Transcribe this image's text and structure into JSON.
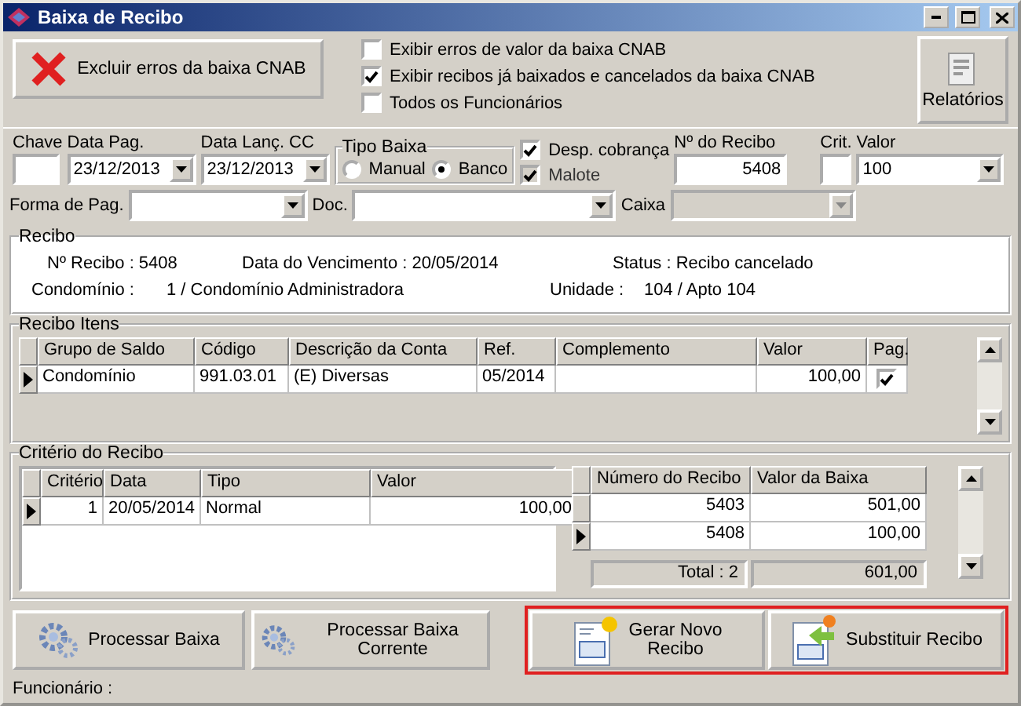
{
  "window": {
    "title": "Baixa de Recibo"
  },
  "toolbar": {
    "delete_button": "Excluir erros da baixa CNAB",
    "checkboxes": [
      {
        "label": "Exibir erros de valor da baixa CNAB",
        "checked": false
      },
      {
        "label": "Exibir recibos já baixados e cancelados da baixa CNAB",
        "checked": true
      },
      {
        "label": "Todos os Funcionários",
        "checked": false
      }
    ],
    "reports_button": "Relatórios"
  },
  "filters": {
    "chave": {
      "label": "Chave"
    },
    "data_pag": {
      "label": "Data Pag.",
      "value": "23/12/2013"
    },
    "data_lanc": {
      "label": "Data Lanç. CC",
      "value": "23/12/2013"
    },
    "tipo_baixa": {
      "label": "Tipo Baixa",
      "options": [
        {
          "label": "Manual",
          "selected": false
        },
        {
          "label": "Banco",
          "selected": true
        }
      ]
    },
    "options": [
      {
        "label": "Desp. cobrança",
        "checked": true,
        "disabled": false
      },
      {
        "label": "Malote",
        "checked": true,
        "disabled": true
      }
    ],
    "numero_recibo": {
      "label": "Nº do Recibo",
      "value": "5408"
    },
    "crit": {
      "label": "Crit."
    },
    "valor": {
      "label": "Valor",
      "value": "100"
    },
    "forma_pag": {
      "label": "Forma de Pag."
    },
    "doc": {
      "label": "Doc."
    },
    "caixa": {
      "label": "Caixa",
      "disabled": true
    }
  },
  "recibo": {
    "title": "Recibo",
    "rows": [
      [
        "Nº Recibo : 5408",
        "Data do Vencimento : 20/05/2014",
        "Status : Recibo cancelado"
      ],
      [
        "Condomínio :",
        "1 /  Condomínio Administradora",
        "Unidade :",
        "104 /  Apto 104"
      ]
    ]
  },
  "recibo_itens": {
    "title": "Recibo Itens",
    "columns": [
      "Grupo de Saldo",
      "Código",
      "Descrição da Conta",
      "Ref.",
      "Complemento",
      "Valor",
      "Pag."
    ],
    "rows": [
      {
        "current": true,
        "cells": [
          "Condomínio",
          "991.03.01",
          "(E) Diversas",
          "05/2014",
          "",
          "100,00"
        ],
        "paid": true
      }
    ]
  },
  "criterio": {
    "title": "Critério do Recibo",
    "columns": [
      "Critério",
      "Data",
      "Tipo",
      "Valor"
    ],
    "rows": [
      {
        "current": true,
        "cells": [
          "1",
          "20/05/2014",
          "Normal",
          "100,00"
        ]
      }
    ],
    "receipts": {
      "columns": [
        "Número do Recibo",
        "Valor da Baixa"
      ],
      "rows": [
        {
          "current": false,
          "cells": [
            "5403",
            "501,00"
          ]
        },
        {
          "current": true,
          "cells": [
            "5408",
            "100,00"
          ]
        }
      ],
      "total_label": "Total : 2",
      "total_value": "601,00"
    }
  },
  "buttons": [
    {
      "label": "Processar Baixa",
      "kind": "gears"
    },
    {
      "label": "Processar Baixa Corrente",
      "kind": "gears"
    }
  ],
  "highlighted_buttons": [
    {
      "label": "Gerar Novo Recibo",
      "kind": "new-form"
    },
    {
      "label": "Substituir Recibo",
      "kind": "replace-form"
    }
  ],
  "status": {
    "label": "Funcionário :"
  }
}
